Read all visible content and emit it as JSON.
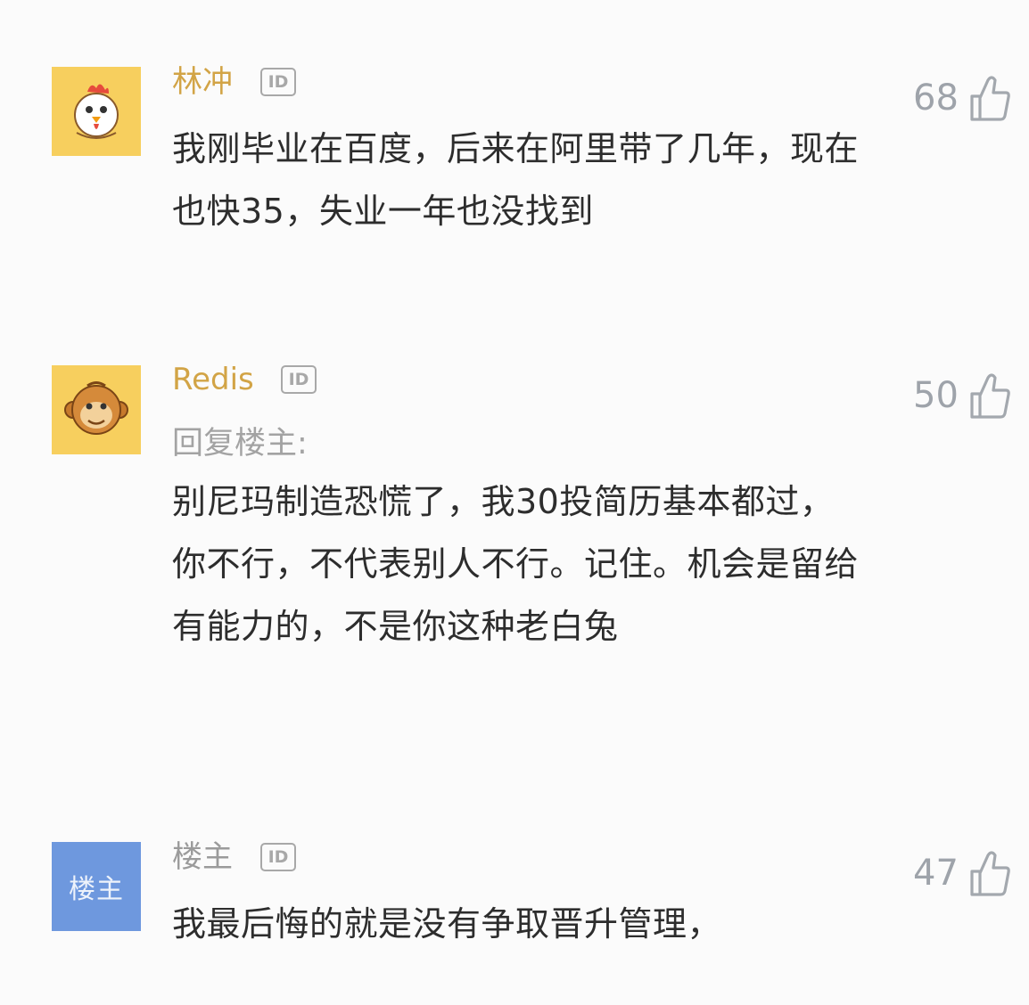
{
  "comments": [
    {
      "author": "林冲",
      "id_badge": "ID",
      "avatar_icon": "rooster-icon",
      "likes": "68",
      "reply_label": "",
      "text": "我刚毕业在百度，后来在阿里带了几年，现在也快35，失业一年也没找到"
    },
    {
      "author": "Redis",
      "id_badge": "ID",
      "avatar_icon": "monkey-icon",
      "likes": "50",
      "reply_label": "回复楼主:",
      "text": "别尼玛制造恐慌了，我30投简历基本都过，你不行，不代表别人不行。记住。机会是留给有能力的，不是你这种老白兔"
    },
    {
      "author": "楼主",
      "id_badge": "ID",
      "avatar_text": "楼主",
      "likes": "47",
      "reply_label": "",
      "text": "我最后悔的就是没有争取晋升管理，"
    }
  ]
}
